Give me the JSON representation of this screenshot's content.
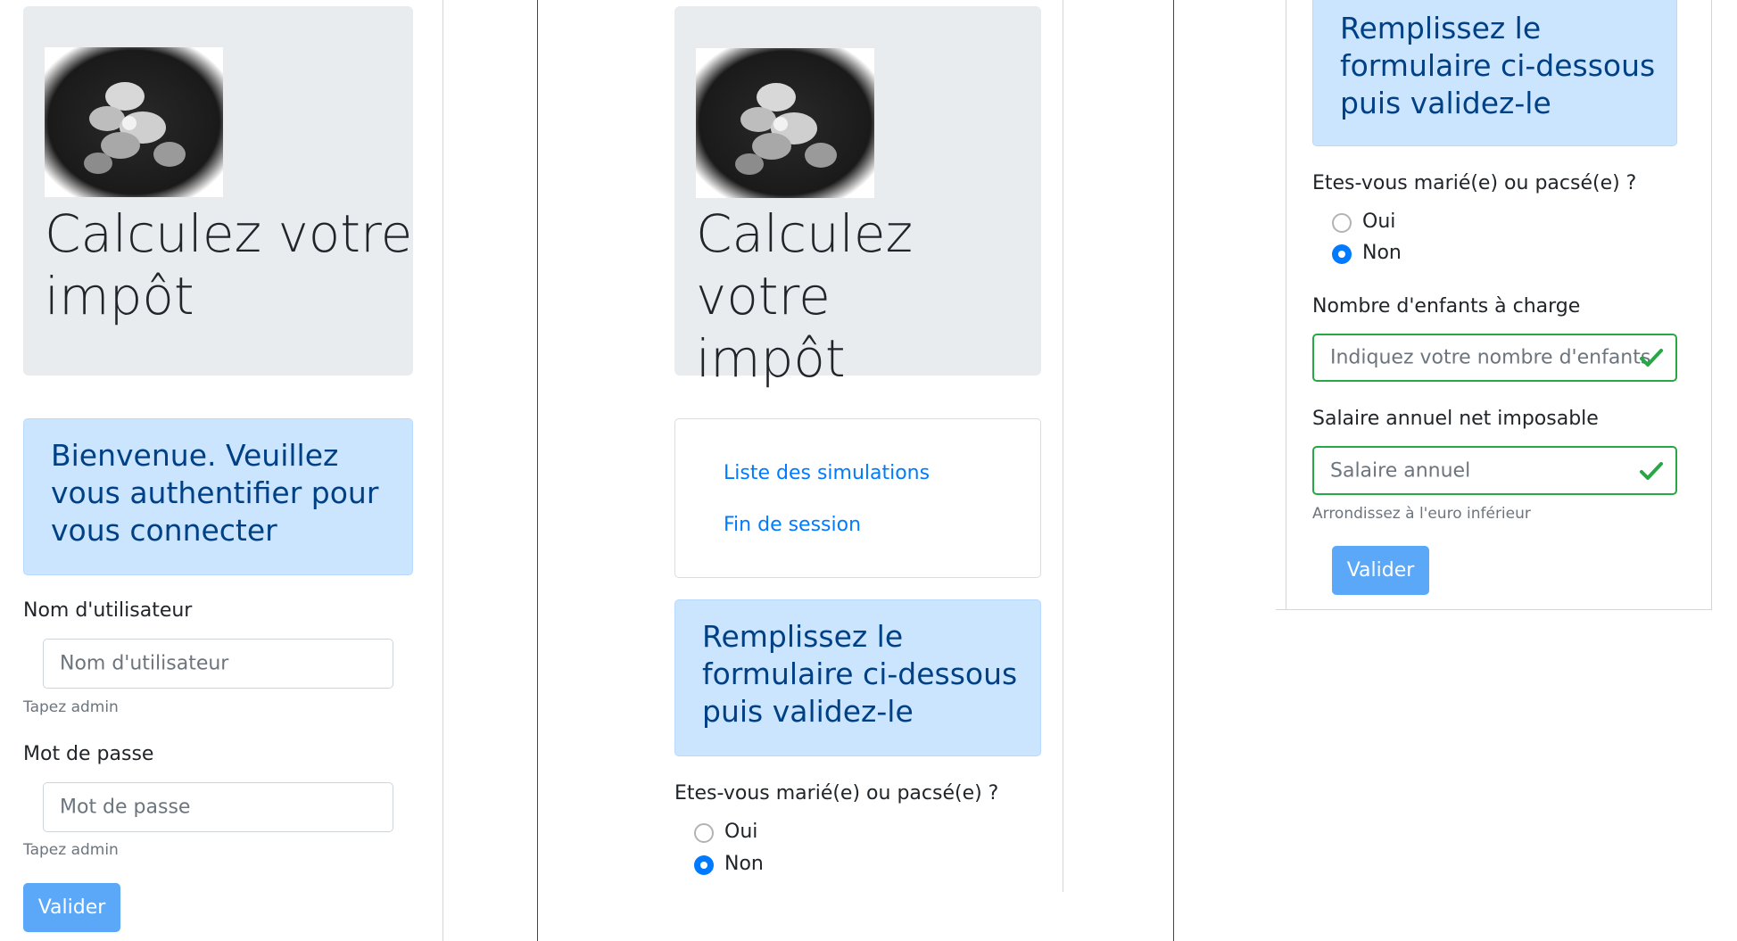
{
  "panel1": {
    "header_title": "Calculez votre\nimpôt",
    "alert": "Bienvenue. Veuillez vous authentifier pour vous connecter",
    "username": {
      "label": "Nom d'utilisateur",
      "placeholder": "Nom d'utilisateur",
      "help": "Tapez admin"
    },
    "password": {
      "label": "Mot de passe",
      "placeholder": "Mot de passe",
      "help": "Tapez admin"
    },
    "submit_label": "Valider"
  },
  "panel2": {
    "header_title": "Calculez votre\nimpôt",
    "menu": [
      "Liste des simulations",
      "Fin de session"
    ],
    "alert": "Remplissez le formulaire ci-dessous puis validez-le",
    "married_question": "Etes-vous marié(e) ou pacsé(e) ?",
    "options": [
      "Oui",
      "Non"
    ],
    "selected_option": "Non"
  },
  "panel3": {
    "alert": "Remplissez le formulaire ci-dessous puis validez-le",
    "married_question": "Etes-vous marié(e) ou pacsé(e) ?",
    "options": [
      "Oui",
      "Non"
    ],
    "selected_option": "Non",
    "children": {
      "label": "Nombre d'enfants à charge",
      "placeholder": "Indiquez votre nombre d'enfants"
    },
    "salary": {
      "label": "Salaire annuel net imposable",
      "placeholder": "Salaire annuel",
      "help": "Arrondissez à l'euro inférieur"
    },
    "submit_label": "Valider"
  },
  "colors": {
    "primary": "#007bff",
    "button": "#5aa8f7",
    "valid": "#28a745",
    "alert_bg": "#cce5ff",
    "alert_text": "#004085",
    "jumbotron_bg": "#e9ecef"
  }
}
